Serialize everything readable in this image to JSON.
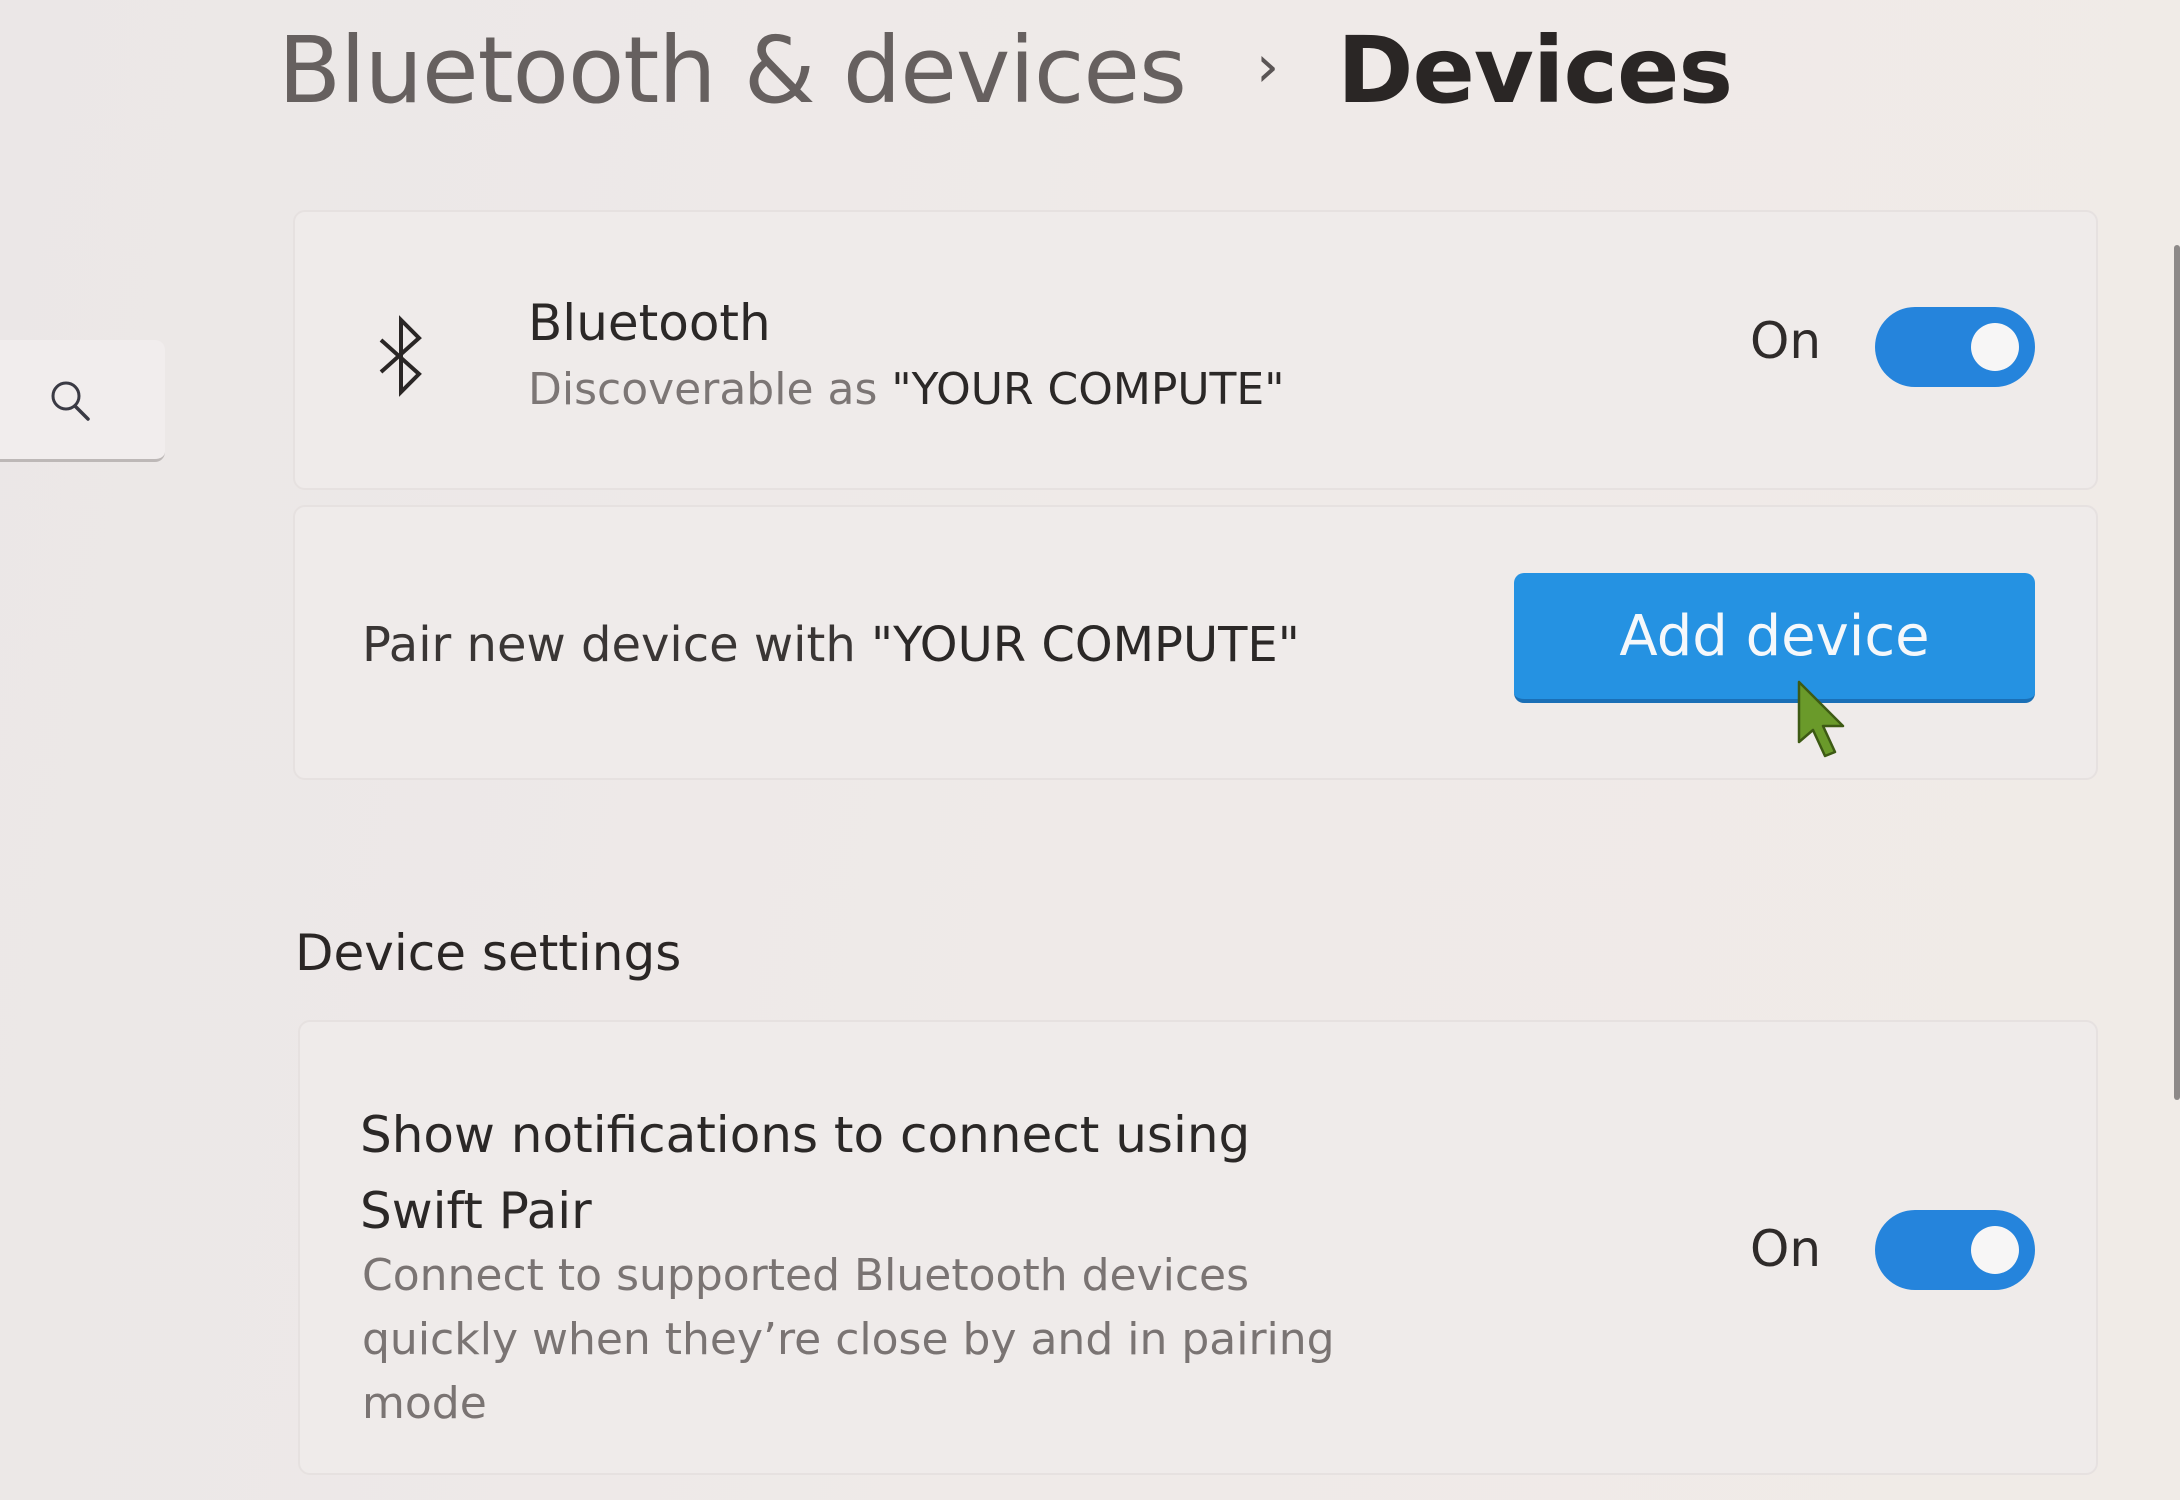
{
  "breadcrumb": {
    "parent": "Bluetooth & devices",
    "separator": "›",
    "current": "Devices"
  },
  "search": {
    "icon": "search-icon"
  },
  "bluetooth_card": {
    "icon": "bluetooth-icon",
    "title": "Bluetooth",
    "subtitle_prefix": "Discoverable as ",
    "device_name": "\"YOUR COMPUTE\"",
    "toggle_label": "On",
    "toggle_state": true
  },
  "pair_card": {
    "text_prefix": "Pair new device with ",
    "device_name": "\"YOUR COMPUTE\"",
    "button_label": "Add device"
  },
  "device_settings": {
    "heading": "Device settings",
    "swift_pair": {
      "title": "Show notifications to connect using Swift Pair",
      "description": "Connect to supported Bluetooth devices quickly when they’re close by and in pairing mode",
      "toggle_label": "On",
      "toggle_state": true
    }
  },
  "colors": {
    "accent": "#2592e2",
    "toggle_on": "#2584dc",
    "cursor": "#6a9a2a"
  }
}
